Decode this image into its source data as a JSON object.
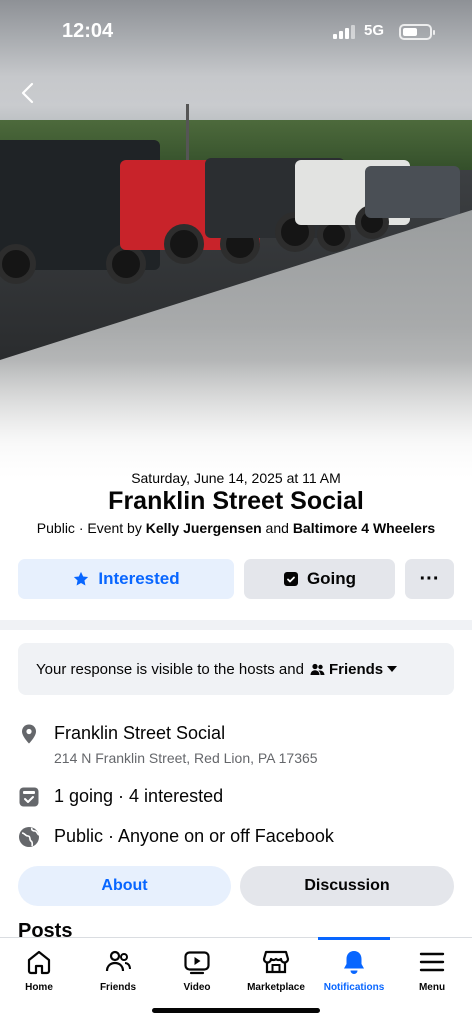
{
  "status_bar": {
    "time": "12:04",
    "network": "5G"
  },
  "event": {
    "date": "Saturday, June 14, 2025 at 11 AM",
    "title": "Franklin Street Social",
    "byline_prefix": "Public · Event by ",
    "host_1": "Kelly Juergensen",
    "byline_and": " and ",
    "host_2": "Baltimore 4 Wheelers"
  },
  "actions": {
    "interested_label": "Interested",
    "going_label": "Going",
    "more_label": "···"
  },
  "notice": {
    "text": "Your response is visible to the hosts and",
    "audience": "Friends"
  },
  "details": {
    "location_name": "Franklin Street Social",
    "location_address": "214 N Franklin Street, Red Lion, PA 17365",
    "attendance": "1 going · 4 interested",
    "privacy": "Public · Anyone on or off Facebook"
  },
  "tabs": {
    "about": "About",
    "discussion": "Discussion"
  },
  "posts_heading": "Posts",
  "nav": {
    "items": [
      {
        "label": "Home",
        "icon": "home-icon"
      },
      {
        "label": "Friends",
        "icon": "friends-icon"
      },
      {
        "label": "Video",
        "icon": "video-icon"
      },
      {
        "label": "Marketplace",
        "icon": "marketplace-icon"
      },
      {
        "label": "Notifications",
        "icon": "bell-icon"
      },
      {
        "label": "Menu",
        "icon": "menu-icon"
      }
    ],
    "active": "Notifications"
  },
  "colors": {
    "accent": "#0866ff",
    "accent_bg": "#e7f0fd",
    "neutral_bg": "#e4e6eb",
    "secondary_text": "#65676b"
  }
}
